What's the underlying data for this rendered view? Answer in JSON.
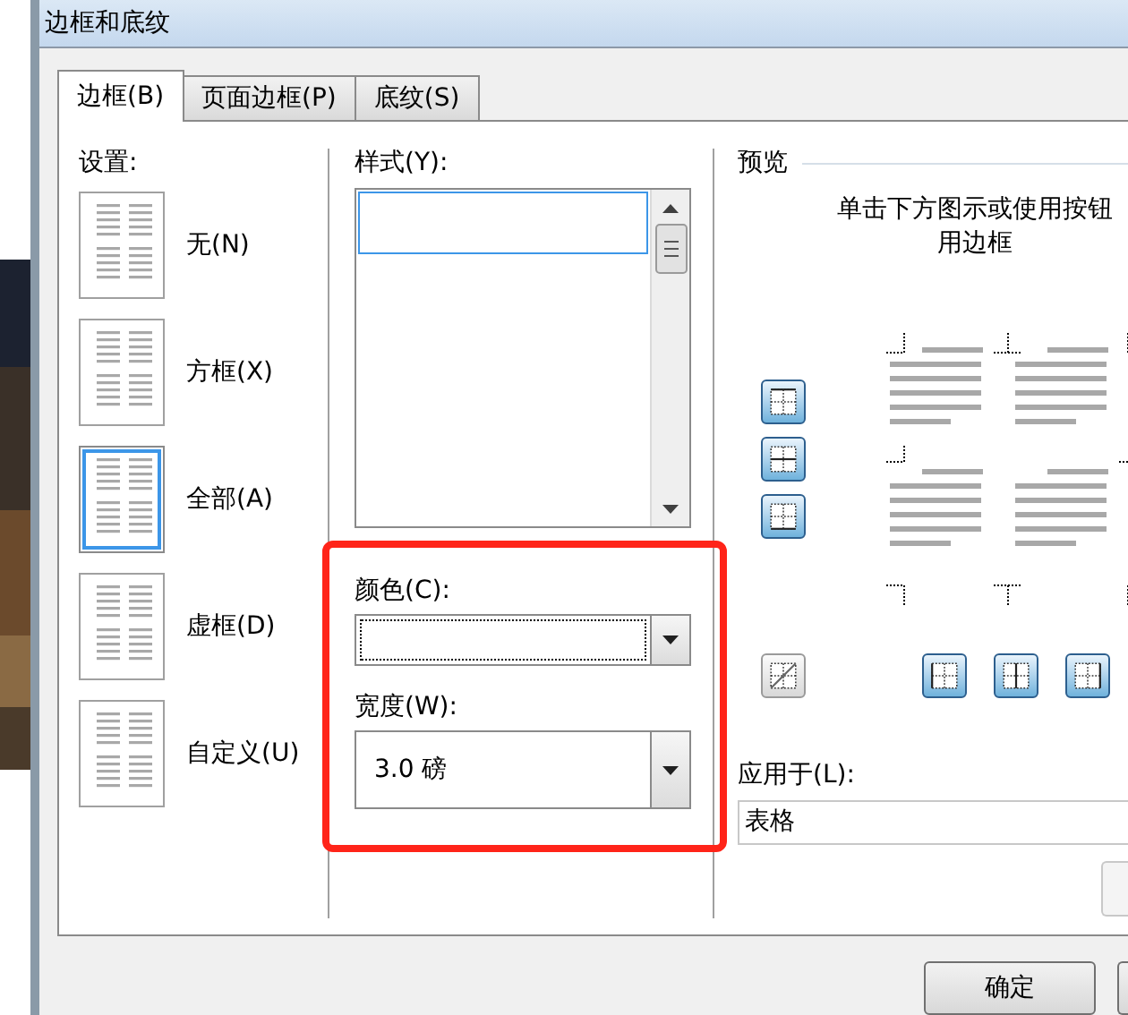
{
  "window": {
    "title": "边框和底纹"
  },
  "tabs": [
    {
      "label": "边框(B)",
      "selected": true
    },
    {
      "label": "页面边框(P)",
      "selected": false
    },
    {
      "label": "底纹(S)",
      "selected": false
    }
  ],
  "settings": {
    "label": "设置:",
    "items": [
      {
        "label": "无(N)",
        "selected": false
      },
      {
        "label": "方框(X)",
        "selected": false
      },
      {
        "label": "全部(A)",
        "selected": true
      },
      {
        "label": "虚框(D)",
        "selected": false
      },
      {
        "label": "自定义(U)",
        "selected": false
      }
    ]
  },
  "style": {
    "label": "样式(Y):"
  },
  "color": {
    "label": "颜色(C):"
  },
  "width": {
    "label": "宽度(W):",
    "value": "3.0 磅"
  },
  "preview": {
    "label": "预览",
    "hint_lines": [
      "单击下方图示或使用按钮",
      "用边框"
    ],
    "side_buttons": [
      {
        "kind": "top",
        "pressed": true
      },
      {
        "kind": "inside-horizontal",
        "pressed": true
      },
      {
        "kind": "bottom",
        "pressed": true
      }
    ],
    "bottom_buttons": [
      {
        "kind": "diagonal",
        "pressed": false
      },
      {
        "kind": "left",
        "pressed": true
      },
      {
        "kind": "inside-vertical",
        "pressed": true
      },
      {
        "kind": "right",
        "pressed": true
      }
    ]
  },
  "apply_to": {
    "label": "应用于(L):",
    "value": "表格"
  },
  "buttons": [
    {
      "label": "确定"
    }
  ],
  "annotation": {
    "kind": "highlight",
    "color": "#ff2419"
  }
}
